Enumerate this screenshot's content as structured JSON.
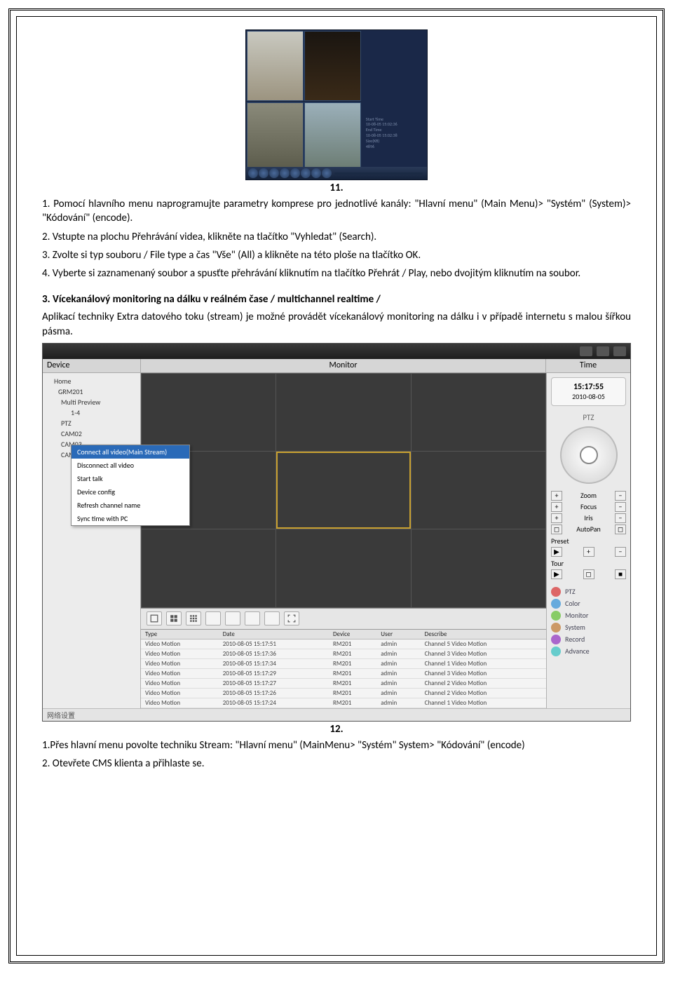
{
  "fig11_caption": "11.",
  "para1": "1. Pomocí hlavního menu naprogramujte parametry komprese pro jednotlivé kanály: \"Hlavní menu\" (Main Menu)> \"Systém\" (System)> \"Kódování\" (encode).",
  "para2": "2. Vstupte na plochu Přehrávání videa, klikněte na tlačítko \"Vyhledat\" (Search).",
  "para3": "3. Zvolte si typ souboru / File type a čas \"Vše\" (All) a klikněte na této ploše na tlačítko OK.",
  "para4": "4. Vyberte si zaznamenaný soubor a spusťte přehrávání kliknutím na tlačítko Přehrát / Play, nebo dvojitým kliknutím na soubor.",
  "heading3": "3. Vícekanálový monitoring na dálku v reálném čase / multichannel realtime /",
  "para5": "Aplikací techniky Extra datového toku (stream) je možné provádět vícekanálový monitoring na dálku i v případě internetu s malou šířkou pásma.",
  "fig12_caption": "12.",
  "para6": "1.Přes hlavní menu povolte techniku Stream: \"Hlavní menu\" (MainMenu> \"Systém\" System> \"Kódování\" (encode)",
  "para7": "2. Otevřete CMS klienta a přihlaste se.",
  "fig11_details": {
    "l1": "Start Time",
    "l2": "10-08-05 15:02:36",
    "l3": "End Time",
    "l4": "10-08-05 15:02:38",
    "l5": "Size(KB)",
    "l6": "4896"
  },
  "cms": {
    "headers": {
      "device": "Device",
      "monitor": "Monitor",
      "time": "Time"
    },
    "tree": {
      "home": "Home",
      "dev": "GRM201",
      "mp": "Multi Preview",
      "l14": "1-4",
      "ptz": "PTZ",
      "cam2": "CAM02",
      "cam3": "CAM03",
      "cam4": "CAM04"
    },
    "ctx": [
      "Connect all video(Main Stream)",
      "Disconnect all video",
      "Start talk",
      "Device config",
      "Refresh channel name",
      "Sync time with PC"
    ],
    "time": {
      "ts": "15:17:55",
      "date": "2010-08-05"
    },
    "ptz_label": "PTZ",
    "controls": {
      "zoom": "Zoom",
      "focus": "Focus",
      "iris": "Iris",
      "autopan": "AutoPan",
      "preset": "Preset",
      "tour": "Tour"
    },
    "links": [
      "PTZ",
      "Color",
      "Monitor",
      "System",
      "Record",
      "Advance"
    ],
    "log_headers": {
      "type": "Type",
      "date": "Date",
      "device": "Device",
      "user": "User",
      "describe": "Describe"
    },
    "log_rows": [
      {
        "type": "Video Motion",
        "date": "2010-08-05 15:17:51",
        "device": "RM201",
        "user": "admin",
        "describe": "Channel 5 Video Motion"
      },
      {
        "type": "Video Motion",
        "date": "2010-08-05 15:17:36",
        "device": "RM201",
        "user": "admin",
        "describe": "Channel 3 Video Motion"
      },
      {
        "type": "Video Motion",
        "date": "2010-08-05 15:17:34",
        "device": "RM201",
        "user": "admin",
        "describe": "Channel 1 Video Motion"
      },
      {
        "type": "Video Motion",
        "date": "2010-08-05 15:17:29",
        "device": "RM201",
        "user": "admin",
        "describe": "Channel 3 Video Motion"
      },
      {
        "type": "Video Motion",
        "date": "2010-08-05 15:17:27",
        "device": "RM201",
        "user": "admin",
        "describe": "Channel 2 Video Motion"
      },
      {
        "type": "Video Motion",
        "date": "2010-08-05 15:17:26",
        "device": "RM201",
        "user": "admin",
        "describe": "Channel 2 Video Motion"
      },
      {
        "type": "Video Motion",
        "date": "2010-08-05 15:17:24",
        "device": "RM201",
        "user": "admin",
        "describe": "Channel 1 Video Motion"
      }
    ],
    "status": "网络设置"
  }
}
